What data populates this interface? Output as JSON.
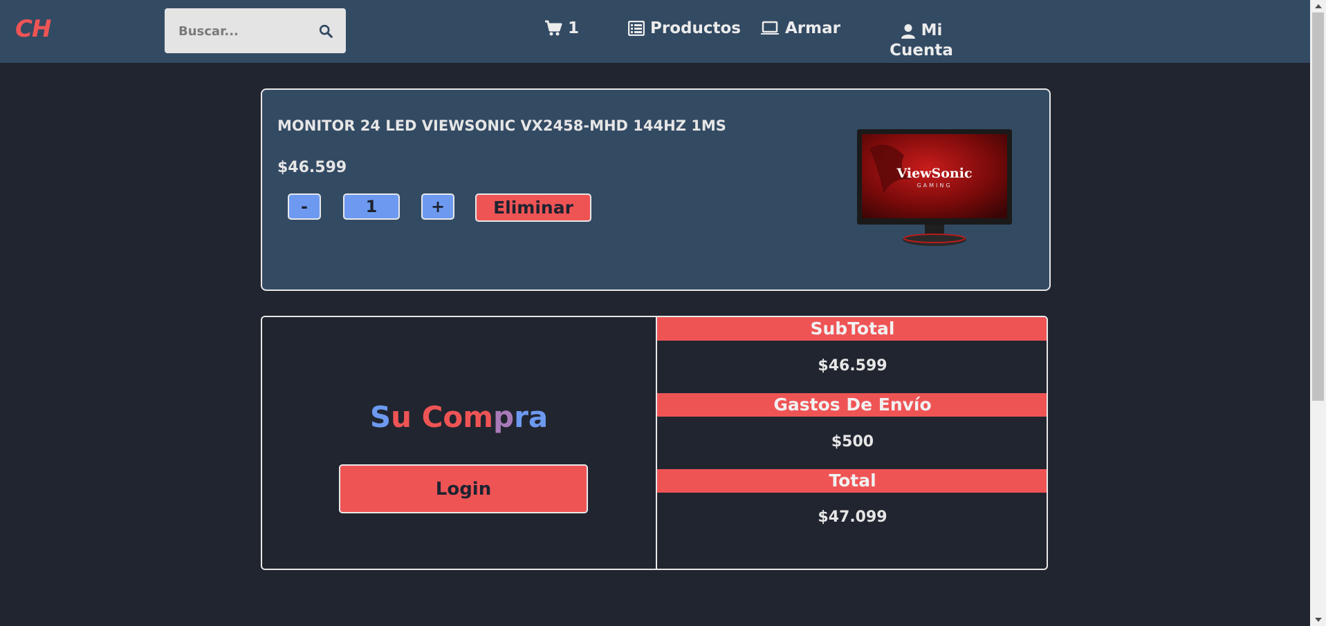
{
  "header": {
    "logo": "CH",
    "search": {
      "placeholder": "Buscar..."
    },
    "cart_count": "1",
    "nav": {
      "productos": "Productos",
      "armar": "Armar",
      "account_line1": "Mi",
      "account_line2": "Cuenta"
    }
  },
  "cart": {
    "item": {
      "name": "MONITOR 24 LED VIEWSONIC VX2458-MHD 144HZ 1MS",
      "price": "$46.599",
      "minus_label": "-",
      "quantity": "1",
      "plus_label": "+",
      "delete_label": "Eliminar",
      "image_brand": "ViewSonic",
      "image_subbrand": "GAMING"
    }
  },
  "summary": {
    "title_parts": [
      "S",
      "u Com",
      "p",
      "ra"
    ],
    "login_label": "Login",
    "subtotal_label": "SubTotal",
    "subtotal_value": "$46.599",
    "shipping_label": "Gastos De Envío",
    "shipping_value": "$500",
    "total_label": "Total",
    "total_value": "$47.099"
  },
  "colors": {
    "navbar": "#334a63",
    "background": "#21252f",
    "accent_red": "#ef5455",
    "accent_blue": "#6d9af0"
  },
  "icons": {
    "search": "search-icon",
    "cart": "cart-icon",
    "list": "list-icon",
    "laptop": "laptop-icon",
    "user": "user-icon"
  }
}
